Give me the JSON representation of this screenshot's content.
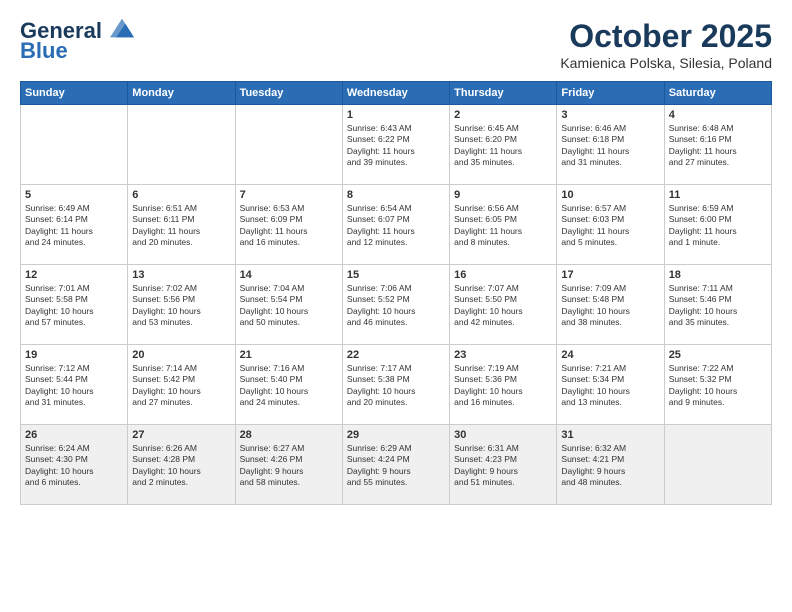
{
  "header": {
    "logo_line1": "General",
    "logo_line2": "Blue",
    "month": "October 2025",
    "location": "Kamienica Polska, Silesia, Poland"
  },
  "weekdays": [
    "Sunday",
    "Monday",
    "Tuesday",
    "Wednesday",
    "Thursday",
    "Friday",
    "Saturday"
  ],
  "weeks": [
    [
      {
        "day": "",
        "text": ""
      },
      {
        "day": "",
        "text": ""
      },
      {
        "day": "",
        "text": ""
      },
      {
        "day": "1",
        "text": "Sunrise: 6:43 AM\nSunset: 6:22 PM\nDaylight: 11 hours\nand 39 minutes."
      },
      {
        "day": "2",
        "text": "Sunrise: 6:45 AM\nSunset: 6:20 PM\nDaylight: 11 hours\nand 35 minutes."
      },
      {
        "day": "3",
        "text": "Sunrise: 6:46 AM\nSunset: 6:18 PM\nDaylight: 11 hours\nand 31 minutes."
      },
      {
        "day": "4",
        "text": "Sunrise: 6:48 AM\nSunset: 6:16 PM\nDaylight: 11 hours\nand 27 minutes."
      }
    ],
    [
      {
        "day": "5",
        "text": "Sunrise: 6:49 AM\nSunset: 6:14 PM\nDaylight: 11 hours\nand 24 minutes."
      },
      {
        "day": "6",
        "text": "Sunrise: 6:51 AM\nSunset: 6:11 PM\nDaylight: 11 hours\nand 20 minutes."
      },
      {
        "day": "7",
        "text": "Sunrise: 6:53 AM\nSunset: 6:09 PM\nDaylight: 11 hours\nand 16 minutes."
      },
      {
        "day": "8",
        "text": "Sunrise: 6:54 AM\nSunset: 6:07 PM\nDaylight: 11 hours\nand 12 minutes."
      },
      {
        "day": "9",
        "text": "Sunrise: 6:56 AM\nSunset: 6:05 PM\nDaylight: 11 hours\nand 8 minutes."
      },
      {
        "day": "10",
        "text": "Sunrise: 6:57 AM\nSunset: 6:03 PM\nDaylight: 11 hours\nand 5 minutes."
      },
      {
        "day": "11",
        "text": "Sunrise: 6:59 AM\nSunset: 6:00 PM\nDaylight: 11 hours\nand 1 minute."
      }
    ],
    [
      {
        "day": "12",
        "text": "Sunrise: 7:01 AM\nSunset: 5:58 PM\nDaylight: 10 hours\nand 57 minutes."
      },
      {
        "day": "13",
        "text": "Sunrise: 7:02 AM\nSunset: 5:56 PM\nDaylight: 10 hours\nand 53 minutes."
      },
      {
        "day": "14",
        "text": "Sunrise: 7:04 AM\nSunset: 5:54 PM\nDaylight: 10 hours\nand 50 minutes."
      },
      {
        "day": "15",
        "text": "Sunrise: 7:06 AM\nSunset: 5:52 PM\nDaylight: 10 hours\nand 46 minutes."
      },
      {
        "day": "16",
        "text": "Sunrise: 7:07 AM\nSunset: 5:50 PM\nDaylight: 10 hours\nand 42 minutes."
      },
      {
        "day": "17",
        "text": "Sunrise: 7:09 AM\nSunset: 5:48 PM\nDaylight: 10 hours\nand 38 minutes."
      },
      {
        "day": "18",
        "text": "Sunrise: 7:11 AM\nSunset: 5:46 PM\nDaylight: 10 hours\nand 35 minutes."
      }
    ],
    [
      {
        "day": "19",
        "text": "Sunrise: 7:12 AM\nSunset: 5:44 PM\nDaylight: 10 hours\nand 31 minutes."
      },
      {
        "day": "20",
        "text": "Sunrise: 7:14 AM\nSunset: 5:42 PM\nDaylight: 10 hours\nand 27 minutes."
      },
      {
        "day": "21",
        "text": "Sunrise: 7:16 AM\nSunset: 5:40 PM\nDaylight: 10 hours\nand 24 minutes."
      },
      {
        "day": "22",
        "text": "Sunrise: 7:17 AM\nSunset: 5:38 PM\nDaylight: 10 hours\nand 20 minutes."
      },
      {
        "day": "23",
        "text": "Sunrise: 7:19 AM\nSunset: 5:36 PM\nDaylight: 10 hours\nand 16 minutes."
      },
      {
        "day": "24",
        "text": "Sunrise: 7:21 AM\nSunset: 5:34 PM\nDaylight: 10 hours\nand 13 minutes."
      },
      {
        "day": "25",
        "text": "Sunrise: 7:22 AM\nSunset: 5:32 PM\nDaylight: 10 hours\nand 9 minutes."
      }
    ],
    [
      {
        "day": "26",
        "text": "Sunrise: 6:24 AM\nSunset: 4:30 PM\nDaylight: 10 hours\nand 6 minutes."
      },
      {
        "day": "27",
        "text": "Sunrise: 6:26 AM\nSunset: 4:28 PM\nDaylight: 10 hours\nand 2 minutes."
      },
      {
        "day": "28",
        "text": "Sunrise: 6:27 AM\nSunset: 4:26 PM\nDaylight: 9 hours\nand 58 minutes."
      },
      {
        "day": "29",
        "text": "Sunrise: 6:29 AM\nSunset: 4:24 PM\nDaylight: 9 hours\nand 55 minutes."
      },
      {
        "day": "30",
        "text": "Sunrise: 6:31 AM\nSunset: 4:23 PM\nDaylight: 9 hours\nand 51 minutes."
      },
      {
        "day": "31",
        "text": "Sunrise: 6:32 AM\nSunset: 4:21 PM\nDaylight: 9 hours\nand 48 minutes."
      },
      {
        "day": "",
        "text": ""
      }
    ]
  ]
}
